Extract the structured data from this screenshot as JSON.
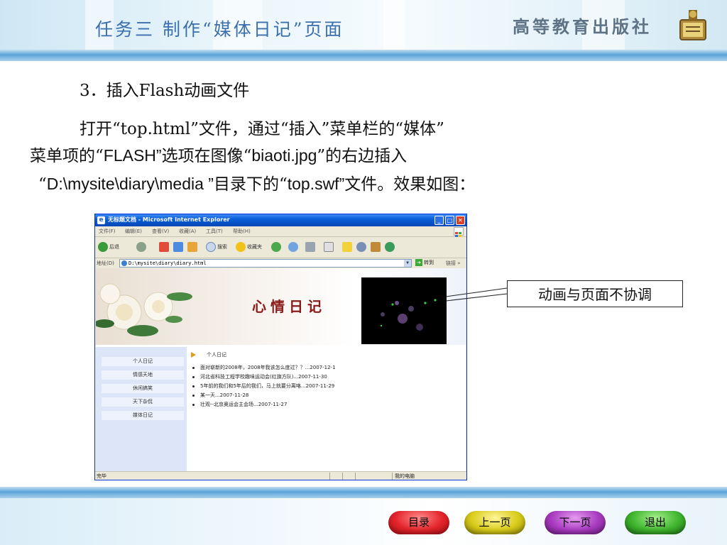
{
  "header": {
    "title": "任务三 制作“媒体日记”页面",
    "publisher": "高等教育出版社"
  },
  "body": {
    "heading": "3．插入Flash动画文件",
    "para_line1": "打开“top.html”文件，通过“插入”菜单栏的“媒体”",
    "para_line2_a": "菜单项的“",
    "para_line2_b": "FLASH”",
    "para_line2_c": "选项在图像“",
    "para_line2_d": "biaoti.jpg",
    "para_line2_e": "”的右边插入",
    "para_line3_a": "“",
    "para_line3_b": "D:\\mysite\\diary\\media ”",
    "para_line3_c": "目录下的“",
    "para_line3_d": "top.swf”",
    "para_line3_e": "文件。效果如图："
  },
  "callout": "动画与页面不协调",
  "browser": {
    "title": "无标题文档 - Microsoft Internet Explorer",
    "min": "_",
    "max": "□",
    "close": "✕",
    "menu": [
      "文件(F)",
      "编辑(E)",
      "查看(V)",
      "收藏(A)",
      "工具(T)",
      "帮助(H)"
    ],
    "toolbar": {
      "back": "后退",
      "search": "搜索",
      "favorites": "收藏夹"
    },
    "address_label": "地址(D)",
    "address_value": "D:\\mysite\\diary\\diary.html",
    "go": "转到",
    "links": "链接 »",
    "page": {
      "banner_title": "心情日记",
      "nav": [
        "个人日记",
        "情感天地",
        "休闲搞笑",
        "天下杂侃",
        "媒体日记"
      ],
      "section_title": "个人日记",
      "entries": [
        "面对崭新的2008年，2008年我该怎么度过？？...2007-12-1",
        "河北省科技工程学校趣味运动会(红旗方队)...2007-11-30",
        "5年前的我们和5年后的我们，马上就要分离咯...2007-11-29",
        "某一天...2007-11-28",
        "壮观--北京奥运会主会场...2007-11-27"
      ]
    },
    "status_done": "完毕",
    "status_zone": "我的电脑"
  },
  "nav_buttons": {
    "toc": "目录",
    "prev": "上一页",
    "next": "下一页",
    "exit": "退出"
  },
  "colors": {
    "title_blue": "#3b6fae",
    "band_blue": "#5aa5da",
    "diary_red": "#8b1a1a"
  }
}
